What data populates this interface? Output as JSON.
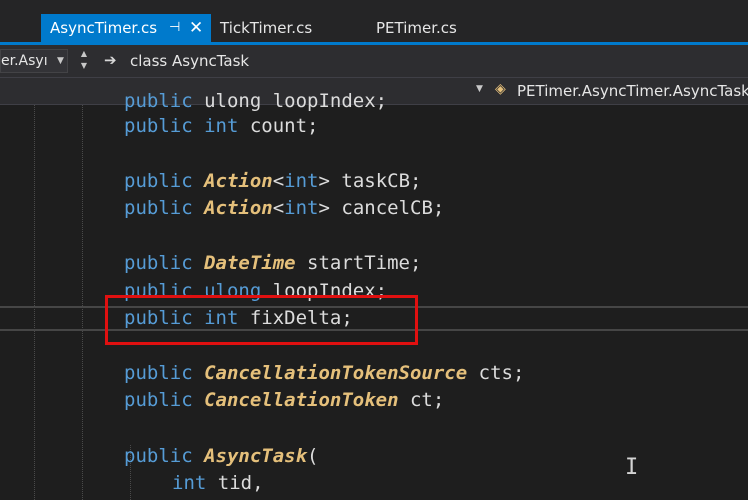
{
  "tabs": [
    {
      "label": "AsyncTimer.cs",
      "active": true,
      "pin_icon": "pin-icon",
      "close_icon": "close-icon"
    },
    {
      "label": "TickTimer.cs",
      "active": false
    },
    {
      "label": "PETimer.cs",
      "active": false
    }
  ],
  "nav": {
    "project": "er.Asyı",
    "class_icon": "arrow-right-icon",
    "class_label": "class AsyncTask"
  },
  "member": {
    "icon": "class-member-icon",
    "label": "PETimer.AsyncTimer.AsyncTask"
  },
  "code": {
    "line0": {
      "kw": "public",
      "rest": " ulong loopIndex;"
    },
    "line1": {
      "kw": "public",
      "kw2": " int",
      "rest": " count;"
    },
    "line3": {
      "kw": "public",
      "type": " Action",
      "rest": "<",
      "kw2": "int",
      "rest2": "> taskCB;"
    },
    "line4": {
      "kw": "public",
      "type": " Action",
      "rest": "<",
      "kw2": "int",
      "rest2": "> cancelCB;"
    },
    "line6": {
      "kw": "public",
      "type": " DateTime",
      "rest": " startTime;"
    },
    "line7": {
      "kw": "public",
      "kw2": " ulong",
      "rest": " loopIndex;"
    },
    "line8": {
      "kw": "public",
      "kw2": " int",
      "rest": " fixDelta;"
    },
    "line10": {
      "kw": "public",
      "type": " CancellationTokenSource",
      "rest": " cts;"
    },
    "line11": {
      "kw": "public",
      "type": " CancellationToken",
      "rest": " ct;"
    },
    "line13": {
      "kw": "public",
      "type": " AsyncTask",
      "rest": "("
    },
    "line14": {
      "kw": "int",
      "rest": " tid,"
    }
  },
  "colors": {
    "accent": "#007acc",
    "keyword": "#569cd6",
    "type": "#e5c07b",
    "highlight_box": "#e01010"
  }
}
